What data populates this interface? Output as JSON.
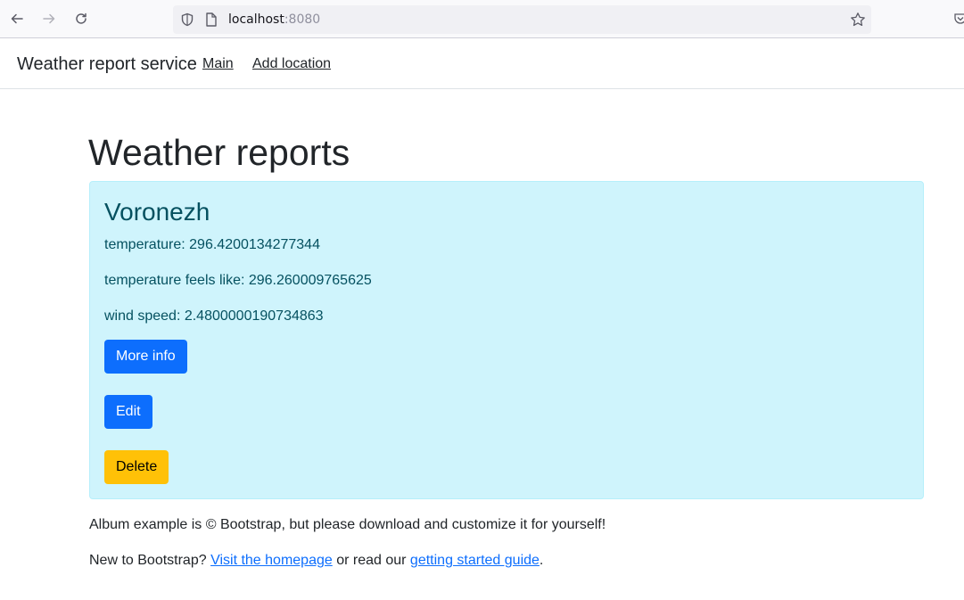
{
  "browser": {
    "url_host": "localhost",
    "url_port": ":8080"
  },
  "navbar": {
    "brand": "Weather report service",
    "links": [
      "Main",
      "Add location"
    ]
  },
  "main": {
    "title": "Weather reports",
    "report": {
      "city": "Voronezh",
      "fields": [
        "temperature: 296.4200134277344",
        "temperature feels like: 296.260009765625",
        "wind speed: 2.4800000190734863"
      ],
      "buttons": {
        "more_info": "More info",
        "edit": "Edit",
        "delete": "Delete"
      }
    }
  },
  "footer": {
    "line1": "Album example is © Bootstrap, but please download and customize it for yourself!",
    "line2_prefix": "New to Bootstrap? ",
    "line2_link1": "Visit the homepage",
    "line2_middle": " or read our ",
    "line2_link2": "getting started guide",
    "line2_suffix": "."
  },
  "colors": {
    "primary": "#0d6efd",
    "warning": "#ffc107",
    "info_bg": "#cff4fc",
    "info_text": "#055160"
  }
}
